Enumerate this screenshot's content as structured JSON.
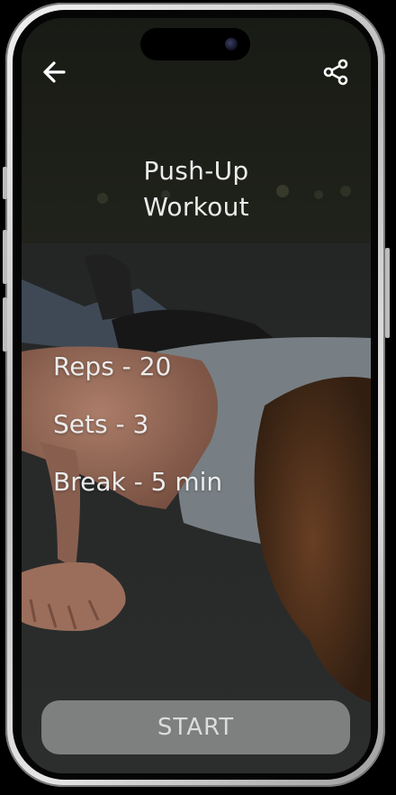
{
  "header": {
    "back_icon": "arrow-left-icon",
    "share_icon": "share-icon"
  },
  "workout": {
    "title_line1": "Push-Up",
    "title_line2": "Workout"
  },
  "stats": {
    "reps": "Reps - 20",
    "sets": "Sets - 3",
    "break": "Break - 5 min"
  },
  "actions": {
    "start_label": "START"
  },
  "colors": {
    "text": "#ececec",
    "button_bg": "#969696",
    "button_text": "#dcdcdc"
  }
}
